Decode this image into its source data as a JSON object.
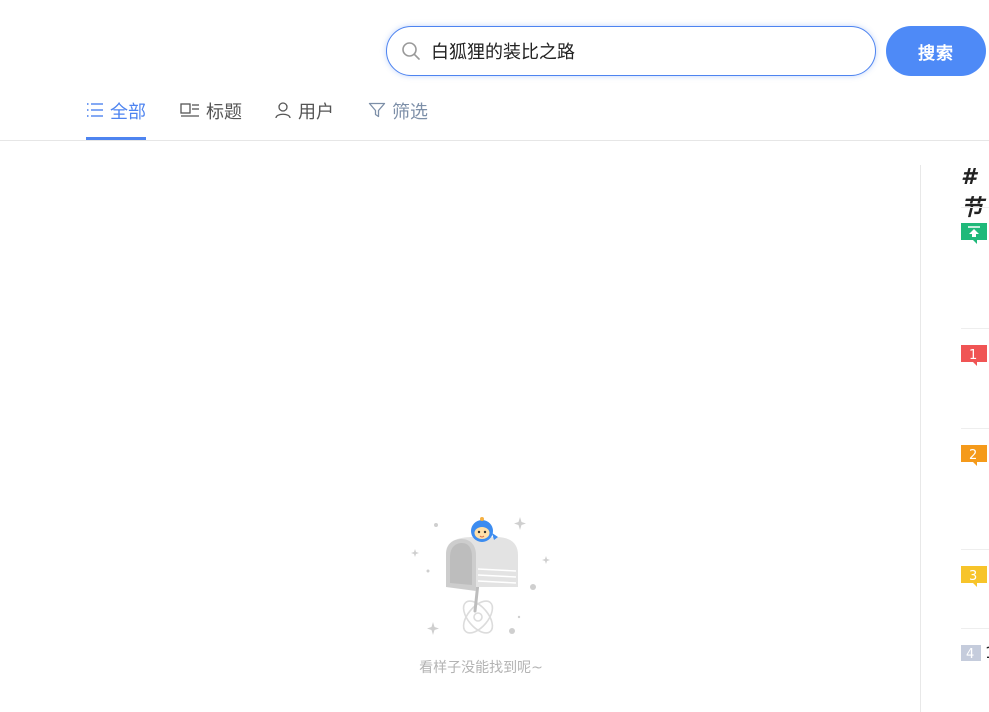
{
  "search": {
    "value": "白狐狸的装比之路",
    "button_label": "搜索"
  },
  "tabs": [
    {
      "label": "全部",
      "icon": "list-icon",
      "active": true
    },
    {
      "label": "标题",
      "icon": "title-icon",
      "active": false
    },
    {
      "label": "用户",
      "icon": "user-icon",
      "active": false
    },
    {
      "label": "筛选",
      "icon": "filter-icon",
      "active": false
    }
  ],
  "sidebar": {
    "heading": "# 节",
    "items": [
      {
        "badge": "top",
        "color": "#1fb97a",
        "text": ""
      },
      {
        "badge": "1",
        "color": "#f05454",
        "text": ""
      },
      {
        "badge": "2",
        "color": "#f59a1a",
        "text": ""
      },
      {
        "badge": "3",
        "color": "#f7c42a",
        "text": ""
      },
      {
        "badge": "4",
        "color": "#c5ccdc",
        "text": "1"
      }
    ]
  },
  "empty_state": {
    "message": "看样子没能找到呢~"
  },
  "colors": {
    "accent": "#4e84f0",
    "button": "#4e8af7",
    "divider": "#e6e6e6"
  }
}
